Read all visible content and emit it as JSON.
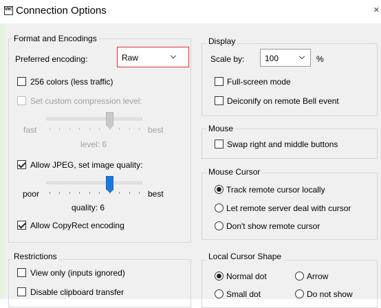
{
  "window": {
    "title": "Connection Options",
    "close_glyph": "×",
    "app_icon_text": "VNC",
    "app_icon": "vnc-icon"
  },
  "format": {
    "legend": "Format and Encodings",
    "preferred_encoding_label": "Preferred encoding:",
    "preferred_encoding_value": "Raw",
    "colors256": {
      "label": "256 colors (less traffic)",
      "checked": false
    },
    "custom_compression": {
      "label": "Set custom compression level:",
      "checked": false,
      "enabled": false
    },
    "compression_slider": {
      "min_label": "fast",
      "max_label": "best",
      "level_text": "level: 6",
      "value": 6,
      "max": 9
    },
    "allow_jpeg": {
      "label": "Allow JPEG, set image quality:",
      "checked": true
    },
    "quality_slider": {
      "min_label": "poor",
      "max_label": "best",
      "quality_text": "quality: 6",
      "value": 6,
      "max": 9
    },
    "copyrect": {
      "label": "Allow CopyRect encoding",
      "checked": true
    }
  },
  "restrictions": {
    "legend": "Restrictions",
    "view_only": {
      "label": "View only (inputs ignored)",
      "checked": false
    },
    "disable_clipboard": {
      "label": "Disable clipboard transfer",
      "checked": false
    }
  },
  "display": {
    "legend": "Display",
    "scale_label": "Scale by:",
    "scale_value": "100",
    "scale_unit": "%",
    "fullscreen": {
      "label": "Full-screen mode",
      "checked": false
    },
    "deiconify": {
      "label": "Deiconify on remote Bell event",
      "checked": false
    }
  },
  "mouse": {
    "legend": "Mouse",
    "swap": {
      "label": "Swap right and middle buttons",
      "checked": false
    }
  },
  "mouse_cursor": {
    "legend": "Mouse Cursor",
    "options": [
      {
        "label": "Track remote cursor locally",
        "selected": true
      },
      {
        "label": "Let remote server deal with cursor",
        "selected": false
      },
      {
        "label": "Don't show remote cursor",
        "selected": false
      }
    ]
  },
  "local_cursor": {
    "legend": "Local Cursor Shape",
    "options": [
      {
        "label": "Normal dot",
        "selected": true
      },
      {
        "label": "Arrow",
        "selected": false
      },
      {
        "label": "Small dot",
        "selected": false
      },
      {
        "label": "Do not show",
        "selected": false
      }
    ]
  }
}
